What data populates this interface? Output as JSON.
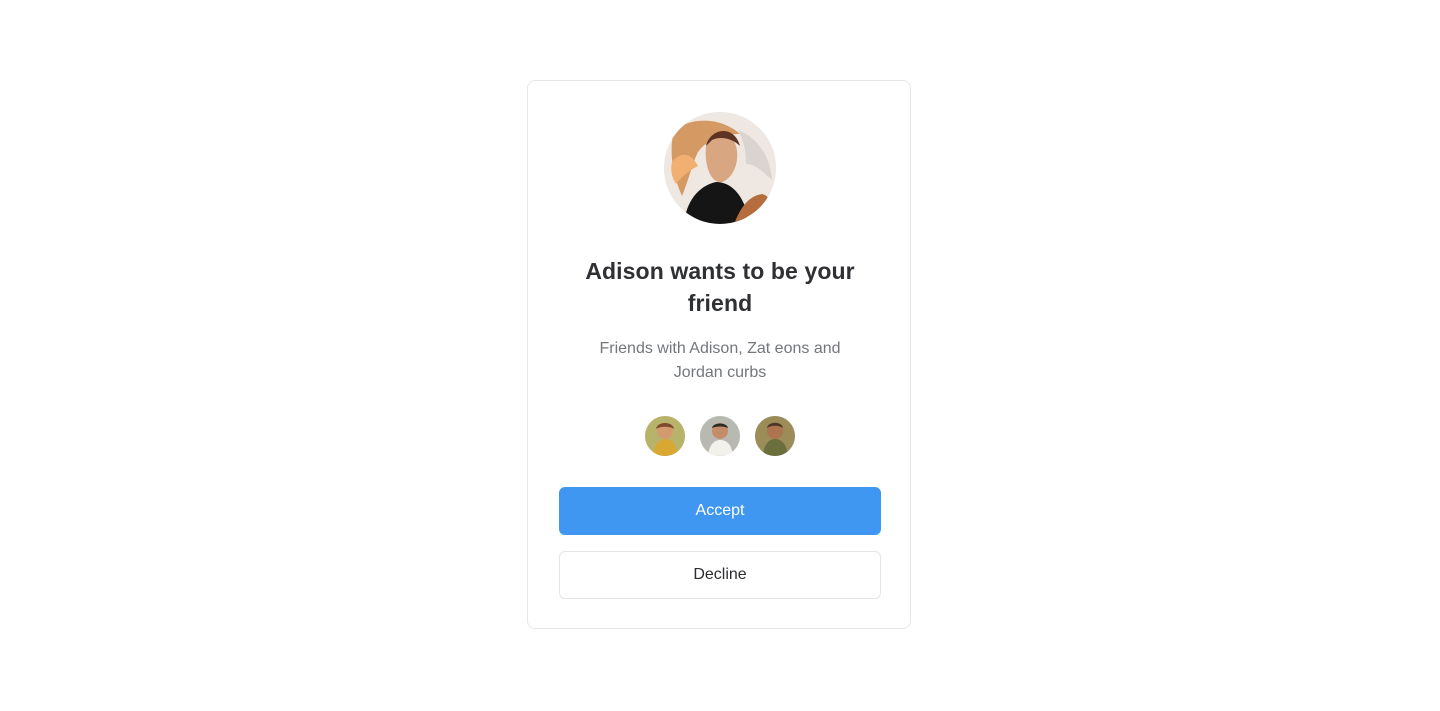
{
  "request": {
    "title": "Adison wants to be your friend",
    "subtitle": "Friends with Adison, Zat eons and Jordan curbs",
    "accept_label": "Accept",
    "decline_label": "Decline"
  },
  "avatars": {
    "requester": "requester-avatar",
    "mutual_friends": [
      "mutual-friend-avatar-1",
      "mutual-friend-avatar-2",
      "mutual-friend-avatar-3"
    ]
  },
  "colors": {
    "accent": "#3f97f2",
    "card_border": "#e6e7ea",
    "heading": "#2f3033",
    "body_text": "#73767c"
  }
}
